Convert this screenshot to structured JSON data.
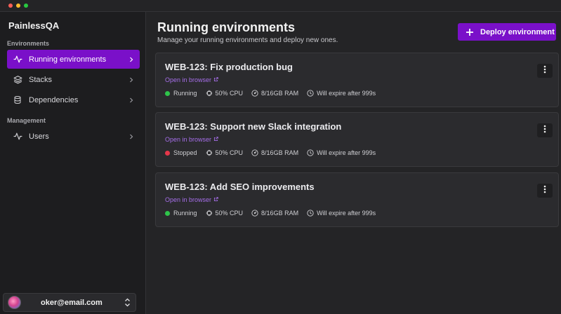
{
  "app": {
    "name": "PainlessQA"
  },
  "sidebar": {
    "sections": [
      {
        "label": "Environments",
        "items": [
          {
            "label": "Running environments",
            "icon": "activity-icon",
            "active": true
          },
          {
            "label": "Stacks",
            "icon": "layers-icon",
            "active": false
          },
          {
            "label": "Dependencies",
            "icon": "database-icon",
            "active": false
          }
        ]
      },
      {
        "label": "Management",
        "items": [
          {
            "label": "Users",
            "icon": "activity-icon",
            "active": false
          }
        ]
      }
    ],
    "user": {
      "email": "oker@email.com"
    }
  },
  "header": {
    "title": "Running environments",
    "subtitle": "Manage your running environments and deploy new ones.",
    "deploy_label": "Deploy environment"
  },
  "environments": [
    {
      "title": "WEB-123: Fix production bug",
      "link": "Open in browser",
      "status": "Running",
      "cpu": "50% CPU",
      "ram": "8/16GB RAM",
      "expiry": "Will expire after 999s"
    },
    {
      "title": "WEB-123: Support new Slack integration",
      "link": "Open in browser",
      "status": "Stopped",
      "cpu": "50% CPU",
      "ram": "8/16GB RAM",
      "expiry": "Will expire after 999s"
    },
    {
      "title": "WEB-123: Add SEO improvements",
      "link": "Open in browser",
      "status": "Running",
      "cpu": "50% CPU",
      "ram": "8/16GB RAM",
      "expiry": "Will expire after 999s"
    }
  ],
  "colors": {
    "accent": "#7a10c9",
    "running": "#2ec44a",
    "stopped": "#e5374a",
    "link": "#a56ee8"
  }
}
